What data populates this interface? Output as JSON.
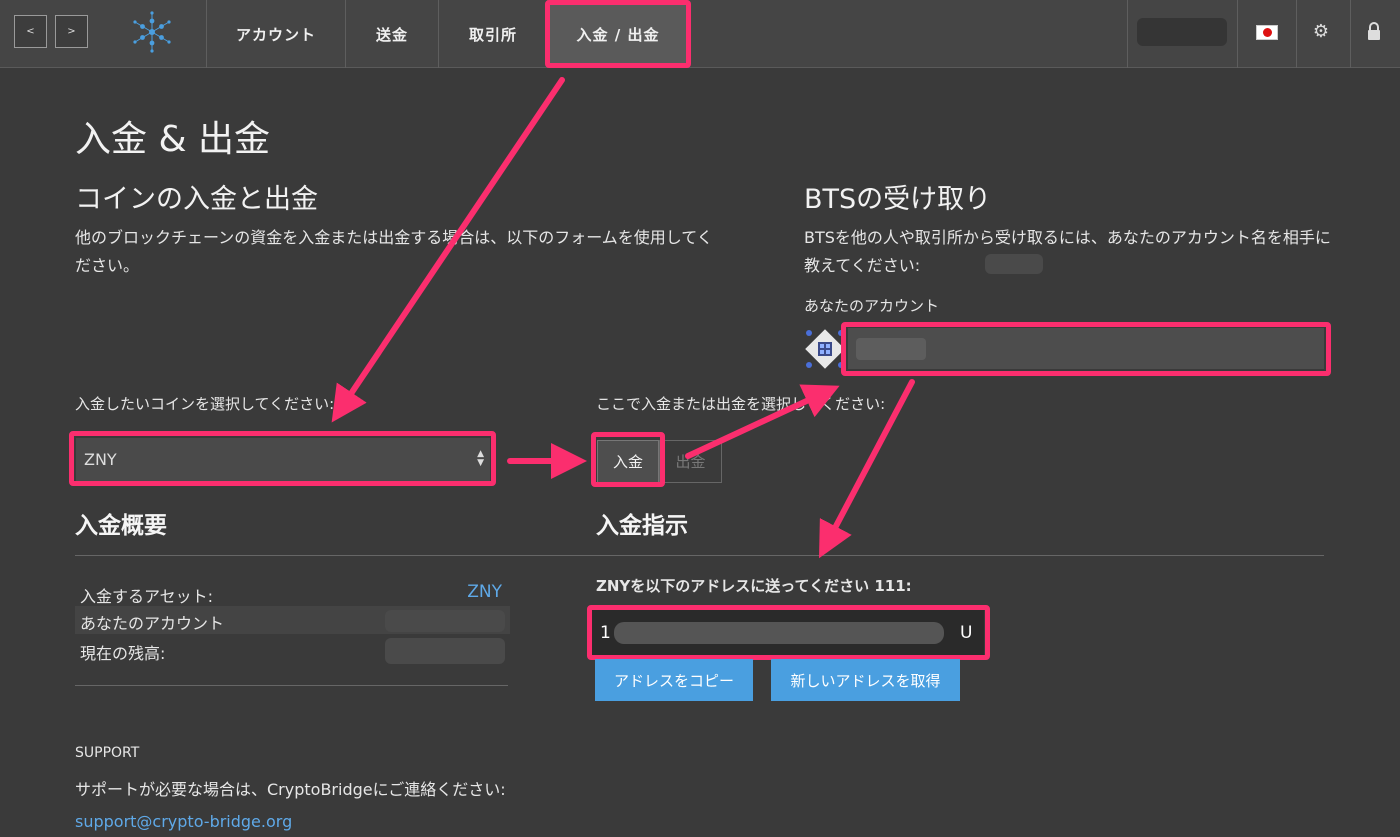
{
  "nav": {
    "back": "<",
    "forward": ">",
    "tabs": [
      "アカウント",
      "送金",
      "取引所",
      "入金 / 出金"
    ]
  },
  "page": {
    "title": "入金 & 出金",
    "left_heading": "コインの入金と出金",
    "left_desc": "他のブロックチェーンの資金を入金または出金する場合は、以下のフォームを使用してください。",
    "right_heading": "BTSの受け取り",
    "right_desc": "BTSを他の人や取引所から受け取るには、あなたのアカウント名を相手に教えてください:",
    "account_label": "あなたのアカウント"
  },
  "form": {
    "coin_label": "入金したいコインを選択してください:",
    "coin_value": "ZNY",
    "action_label": "ここで入金または出金を選択してください:",
    "deposit_btn": "入金",
    "withdraw_btn": "出金"
  },
  "summary": {
    "heading": "入金概要",
    "rows": [
      {
        "label": "入金するアセット:",
        "value": "ZNY"
      },
      {
        "label": "あなたのアカウント",
        "value": ""
      },
      {
        "label": "現在の残高:",
        "value": ""
      }
    ]
  },
  "instructions": {
    "heading": "入金指示",
    "text": "ZNYを以下のアドレスに送ってください 111:",
    "addr_start": "1",
    "addr_end": "U",
    "copy_btn": "アドレスをコピー",
    "new_btn": "新しいアドレスを取得"
  },
  "support": {
    "heading": "SUPPORT",
    "text": "サポートが必要な場合は、CryptoBridgeにご連絡ください:",
    "email": "support@crypto-bridge.org"
  },
  "colors": {
    "background": "#3a3a3a",
    "nav": "#454545",
    "highlight": "#fb2e6e",
    "accent_blue": "#4a9fe0",
    "link": "#5fa9e8"
  }
}
